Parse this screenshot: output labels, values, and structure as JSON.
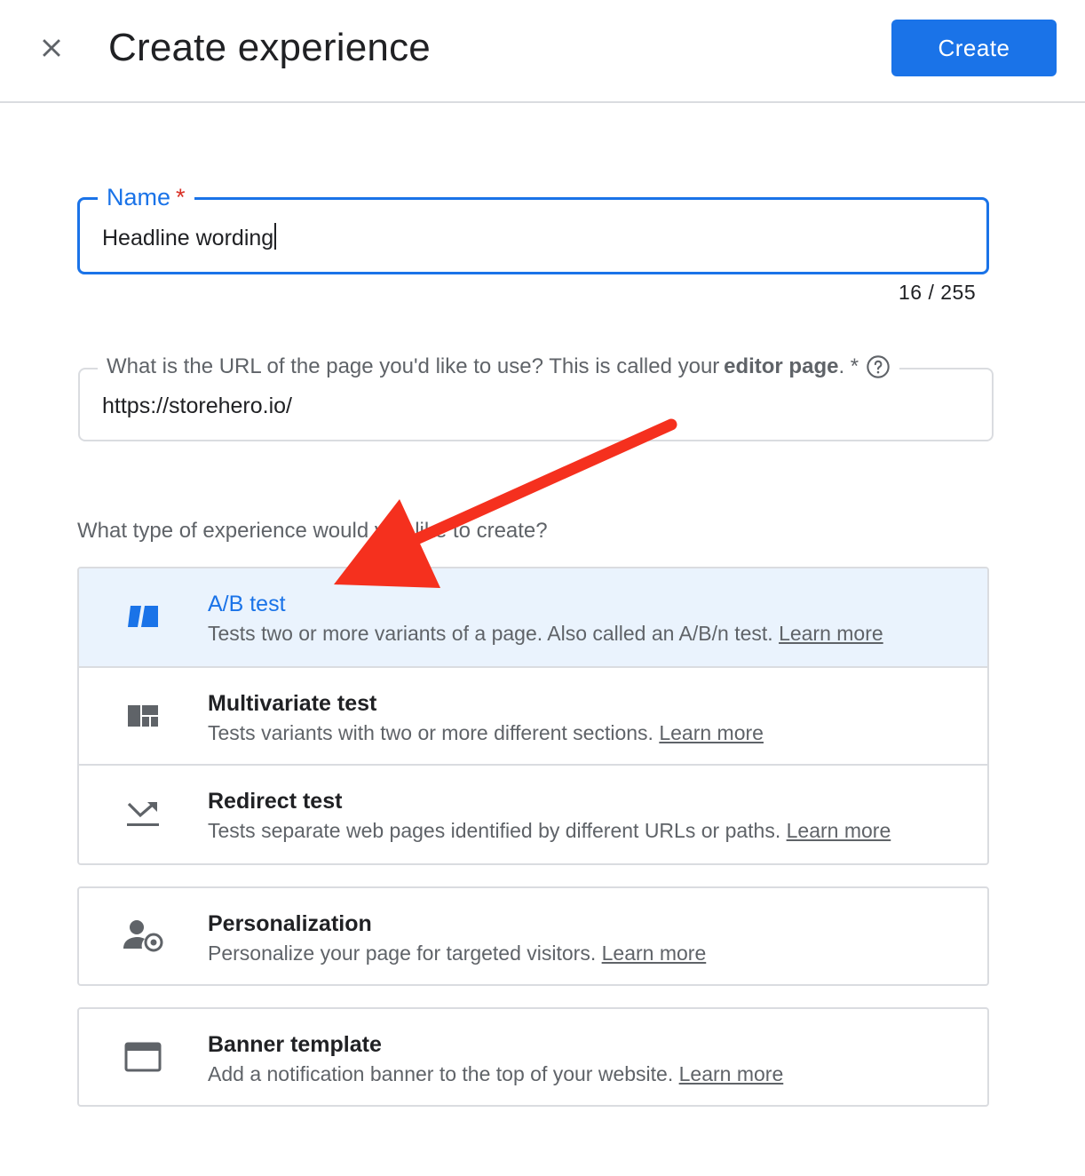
{
  "header": {
    "title": "Create experience",
    "create_label": "Create"
  },
  "name_field": {
    "label": "Name",
    "required_mark": "*",
    "value": "Headline wording",
    "counter": "16 / 255"
  },
  "url_field": {
    "label_prefix": "What is the URL of the page you'd like to use? This is called your ",
    "label_bold": "editor page",
    "label_suffix": ". *",
    "value": "https://storehero.io/"
  },
  "question": "What type of experience would you like to create?",
  "options": [
    {
      "title": "A/B test",
      "desc": "Tests two or more variants of a page. Also called an A/B/n test.",
      "link": "Learn more",
      "icon": "ab-test-icon",
      "selected": true
    },
    {
      "title": "Multivariate test",
      "desc": "Tests variants with two or more different sections.",
      "link": "Learn more",
      "icon": "multivariate-icon",
      "selected": false
    },
    {
      "title": "Redirect test",
      "desc": "Tests separate web pages identified by different URLs or paths.",
      "link": "Learn more",
      "icon": "redirect-icon",
      "selected": false
    },
    {
      "title": "Personalization",
      "desc": "Personalize your page for targeted visitors.",
      "link": "Learn more",
      "icon": "personalization-icon",
      "selected": false
    },
    {
      "title": "Banner template",
      "desc": "Add a notification banner to the top of your website.",
      "link": "Learn more",
      "icon": "banner-icon",
      "selected": false
    }
  ],
  "colors": {
    "accent": "#1a73e8",
    "required": "#d93025",
    "arrow": "#f5301e",
    "selected_bg": "#eaf3fd"
  }
}
